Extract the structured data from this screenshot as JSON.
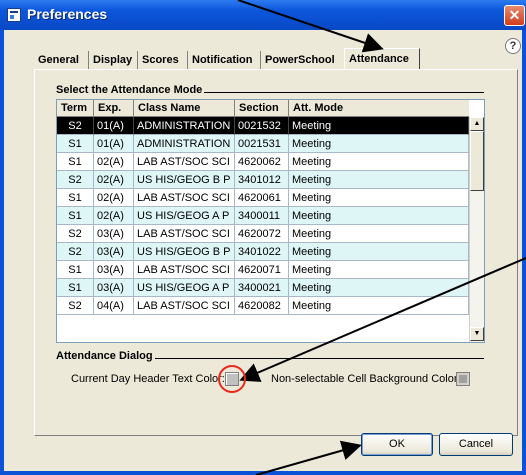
{
  "window": {
    "title": "Preferences",
    "close_glyph": "✕",
    "help_glyph": "?"
  },
  "tabs": [
    {
      "label": "General"
    },
    {
      "label": "Display"
    },
    {
      "label": "Scores"
    },
    {
      "label": "Notification"
    },
    {
      "label": "PowerSchool"
    },
    {
      "label": "Attendance",
      "active": true
    }
  ],
  "attendance_mode": {
    "group_title": "Select the Attendance Mode",
    "columns": [
      "Term",
      "Exp.",
      "Class Name",
      "Section",
      "Att. Mode"
    ],
    "rows": [
      {
        "term": "S2",
        "exp": "01(A)",
        "class_name": "ADMINISTRATION",
        "section": "0021532",
        "mode": "Meeting",
        "selected": true
      },
      {
        "term": "S1",
        "exp": "01(A)",
        "class_name": "ADMINISTRATION",
        "section": "0021531",
        "mode": "Meeting"
      },
      {
        "term": "S1",
        "exp": "02(A)",
        "class_name": "LAB AST/SOC SCI",
        "section": "4620062",
        "mode": "Meeting"
      },
      {
        "term": "S2",
        "exp": "02(A)",
        "class_name": "US HIS/GEOG B P",
        "section": "3401012",
        "mode": "Meeting"
      },
      {
        "term": "S1",
        "exp": "02(A)",
        "class_name": "LAB AST/SOC SCI",
        "section": "4620061",
        "mode": "Meeting"
      },
      {
        "term": "S1",
        "exp": "02(A)",
        "class_name": "US HIS/GEOG A P",
        "section": "3400011",
        "mode": "Meeting"
      },
      {
        "term": "S2",
        "exp": "03(A)",
        "class_name": "LAB AST/SOC SCI",
        "section": "4620072",
        "mode": "Meeting"
      },
      {
        "term": "S2",
        "exp": "03(A)",
        "class_name": "US HIS/GEOG B P",
        "section": "3401022",
        "mode": "Meeting"
      },
      {
        "term": "S1",
        "exp": "03(A)",
        "class_name": "LAB AST/SOC SCI",
        "section": "4620071",
        "mode": "Meeting"
      },
      {
        "term": "S1",
        "exp": "03(A)",
        "class_name": "US HIS/GEOG A P",
        "section": "3400021",
        "mode": "Meeting"
      },
      {
        "term": "S2",
        "exp": "04(A)",
        "class_name": "LAB AST/SOC SCI",
        "section": "4620082",
        "mode": "Meeting"
      }
    ],
    "row_alt_color": "#dff6f6",
    "selected_color": "#000000"
  },
  "attendance_dialog": {
    "group_title": "Attendance Dialog",
    "current_day_label": "Current Day Header Text Color:",
    "non_selectable_label": "Non-selectable Cell Background Color:"
  },
  "buttons": {
    "ok": "OK",
    "cancel": "Cancel"
  },
  "annotation": {
    "arrow_color": "#000000",
    "circle_color": "#e8281e"
  }
}
